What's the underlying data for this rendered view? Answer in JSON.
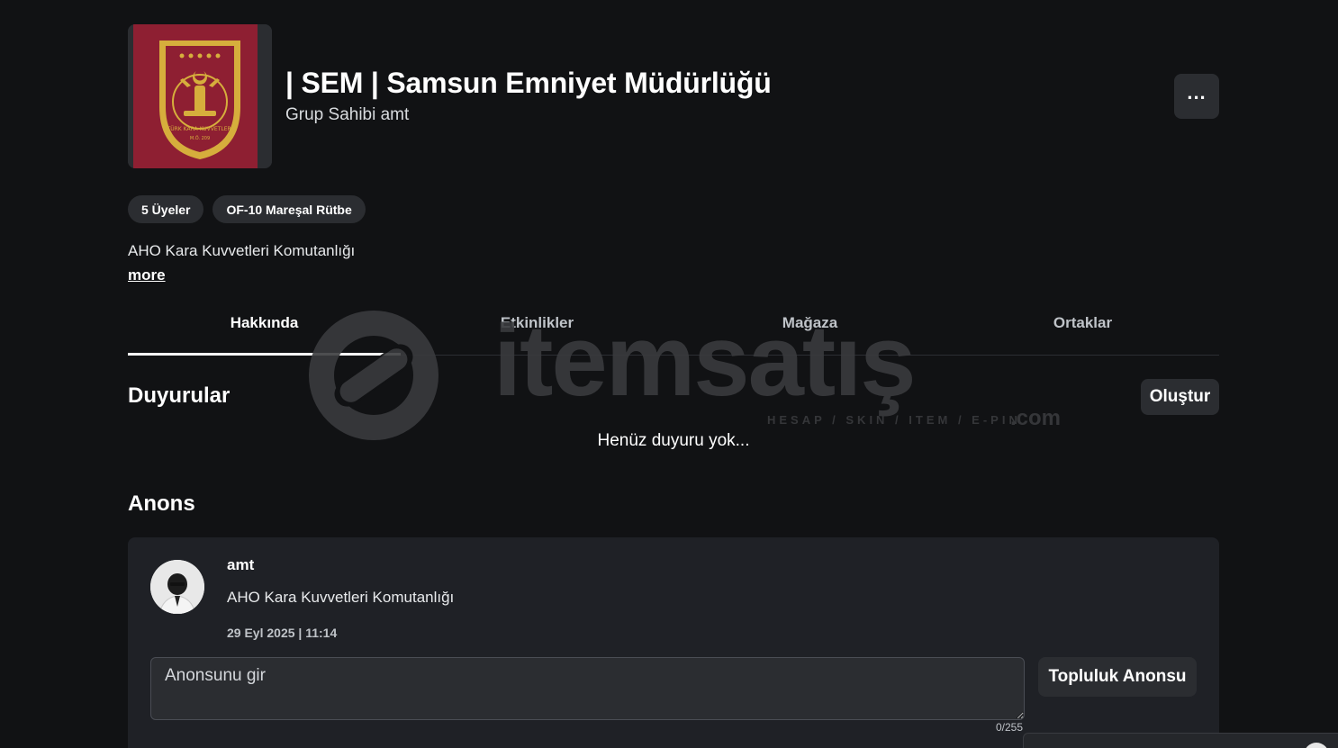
{
  "group": {
    "title": "| SEM | Samsun Emniyet Müdürlüğü",
    "owner_line": "Grup Sahibi amt",
    "emblem_text": "TÜRK KARA KUVVETLERİ",
    "emblem_year": "M.Ö. 209",
    "description": "AHO Kara Kuvvetleri Komutanlığı",
    "more_label": "more",
    "badges": [
      "5 Üyeler",
      "OF-10 Mareşal Rütbe"
    ],
    "menu_icon": "ellipsis-icon",
    "menu_symbol": "..."
  },
  "tabs": [
    "Hakkında",
    "Etkinlikler",
    "Mağaza",
    "Ortaklar"
  ],
  "active_tab": "Hakkında",
  "announcements": {
    "heading": "Duyurular",
    "create_label": "Oluştur",
    "empty_text": "Henüz duyuru yok..."
  },
  "shout": {
    "heading": "Anons",
    "poster": "amt",
    "text": "AHO Kara Kuvvetleri Komutanlığı",
    "date": "29 Eyl 2025 | 11:14",
    "input_placeholder": "Anonsunu gir",
    "char_count": "0/255",
    "submit_label": "Topluluk Anonsu"
  },
  "watermark": {
    "brand": "itemsatış",
    "tagline": "HESAP / SKIN / ITEM / E-PIN",
    "suffix": ".com"
  },
  "colors": {
    "background": "#111214",
    "surface": "#2b2d31",
    "card": "#1f2126",
    "emblem_red": "#8e1f32",
    "emblem_gold": "#d6ae3c"
  }
}
